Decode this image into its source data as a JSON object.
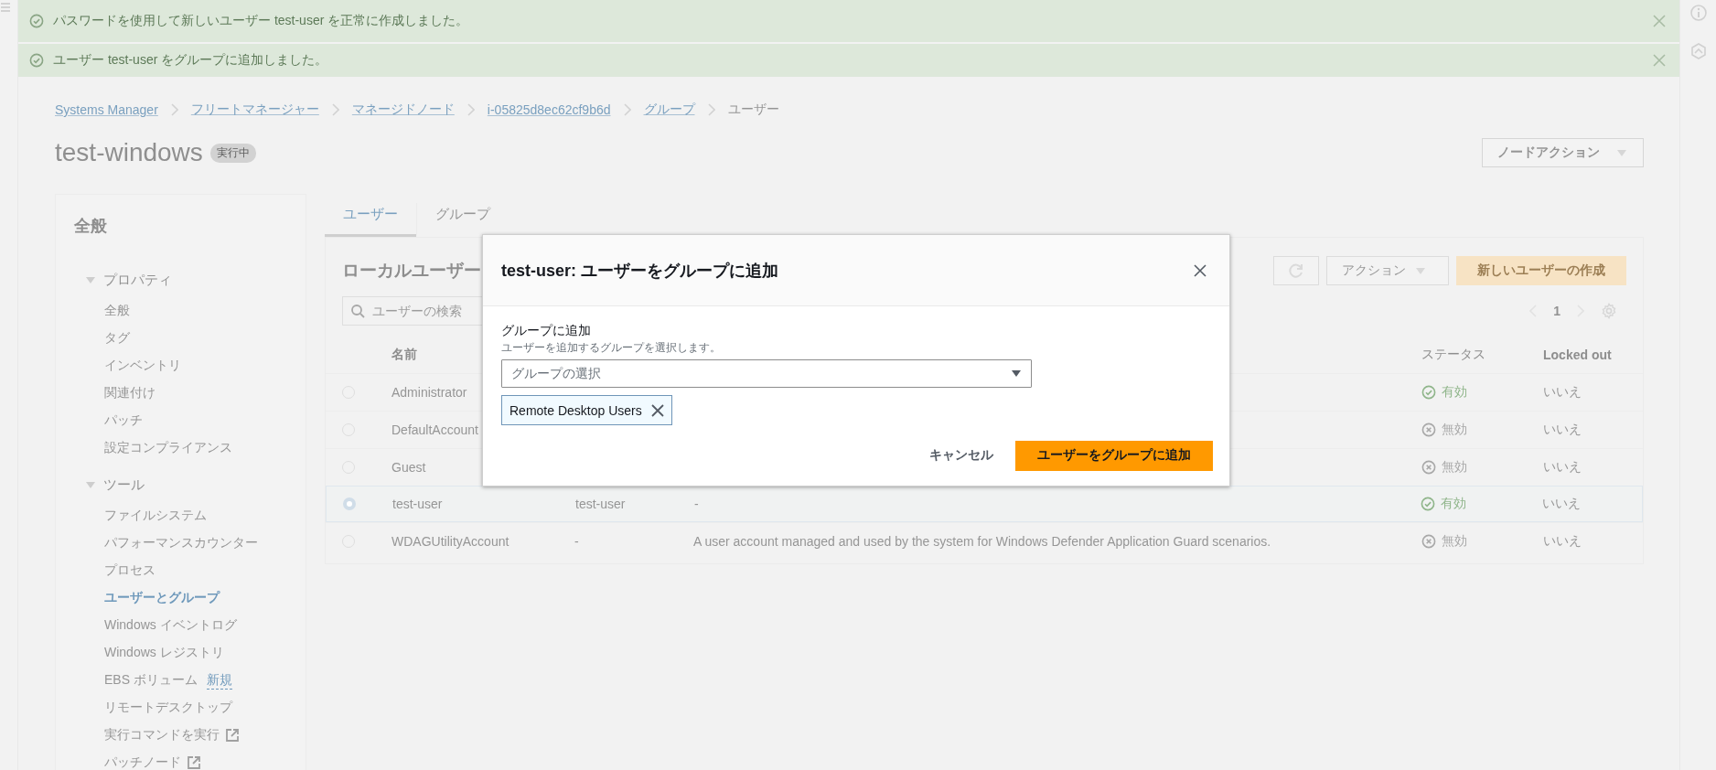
{
  "flashbar": [
    {
      "kind": "success",
      "message": "パスワードを使用して新しいユーザー test-user を正常に作成しました。"
    },
    {
      "kind": "success",
      "message": "ユーザー test-user をグループに追加しました。"
    }
  ],
  "breadcrumbs": [
    {
      "label": "Systems Manager",
      "link": true
    },
    {
      "label": "フリートマネージャー",
      "link": true
    },
    {
      "label": "マネージドノード",
      "link": true
    },
    {
      "label": "i-05825d8ec62cf9b6d",
      "link": true
    },
    {
      "label": "グループ",
      "link": true
    },
    {
      "label": "ユーザー",
      "link": false
    }
  ],
  "page": {
    "title": "test-windows",
    "status_badge": "実行中",
    "node_actions_button": "ノードアクション"
  },
  "side_nav": {
    "header": "全般",
    "sections": [
      {
        "label": "プロパティ",
        "expanded": true,
        "items": [
          {
            "label": "全般",
            "selected": false
          },
          {
            "label": "タグ",
            "selected": false
          },
          {
            "label": "インベントリ",
            "selected": false
          },
          {
            "label": "関連付け",
            "selected": false
          },
          {
            "label": "パッチ",
            "selected": false
          },
          {
            "label": "設定コンプライアンス",
            "selected": false
          }
        ]
      },
      {
        "label": "ツール",
        "expanded": true,
        "items": [
          {
            "label": "ファイルシステム",
            "selected": false
          },
          {
            "label": "パフォーマンスカウンター",
            "selected": false
          },
          {
            "label": "プロセス",
            "selected": false
          },
          {
            "label": "ユーザーとグループ",
            "selected": true
          },
          {
            "label": "Windows イベントログ",
            "selected": false
          },
          {
            "label": "Windows レジストリ",
            "selected": false
          },
          {
            "label": "EBS ボリューム",
            "selected": false,
            "badge": "新規"
          },
          {
            "label": "リモートデスクトップ",
            "selected": false
          },
          {
            "label": "実行コマンドを実行",
            "selected": false,
            "external": true
          },
          {
            "label": "パッチノード",
            "selected": false,
            "external": true
          }
        ]
      }
    ]
  },
  "tabs": [
    {
      "label": "ユーザー",
      "selected": true
    },
    {
      "label": "グループ",
      "selected": false
    }
  ],
  "users_panel": {
    "title": "ローカルユーザー",
    "actions_button": "アクション",
    "create_button": "新しいユーザーの作成",
    "search_placeholder": "ユーザーの検索",
    "current_page": "1",
    "columns": {
      "name": "名前",
      "status": "ステータス",
      "locked_out": "Locked out"
    },
    "rows": [
      {
        "selected": false,
        "name": "Administrator",
        "status": {
          "kind": "enabled",
          "label": "有効"
        },
        "locked_out": "いいえ"
      },
      {
        "selected": false,
        "name": "DefaultAccount",
        "status": {
          "kind": "disabled",
          "label": "無効"
        },
        "locked_out": "いいえ"
      },
      {
        "selected": false,
        "name": "Guest",
        "status": {
          "kind": "disabled",
          "label": "無効"
        },
        "locked_out": "いいえ"
      },
      {
        "selected": true,
        "name": "test-user",
        "column_2": "test-user",
        "column_3": "-",
        "status": {
          "kind": "enabled",
          "label": "有効"
        },
        "locked_out": "いいえ"
      },
      {
        "selected": false,
        "name": "WDAGUtilityAccount",
        "column_2": "-",
        "column_3": "A user account managed and used by the system for Windows Defender Application Guard scenarios.",
        "status": {
          "kind": "disabled",
          "label": "無効"
        },
        "locked_out": "いいえ"
      }
    ]
  },
  "modal": {
    "title": "test-user: ユーザーをグループに追加",
    "field_label": "グループに追加",
    "field_description": "ユーザーを追加するグループを選択します。",
    "select_placeholder": "グループの選択",
    "tokens": [
      {
        "label": "Remote Desktop Users"
      }
    ],
    "cancel_button": "キャンセル",
    "submit_button": "ユーザーをグループに追加"
  }
}
